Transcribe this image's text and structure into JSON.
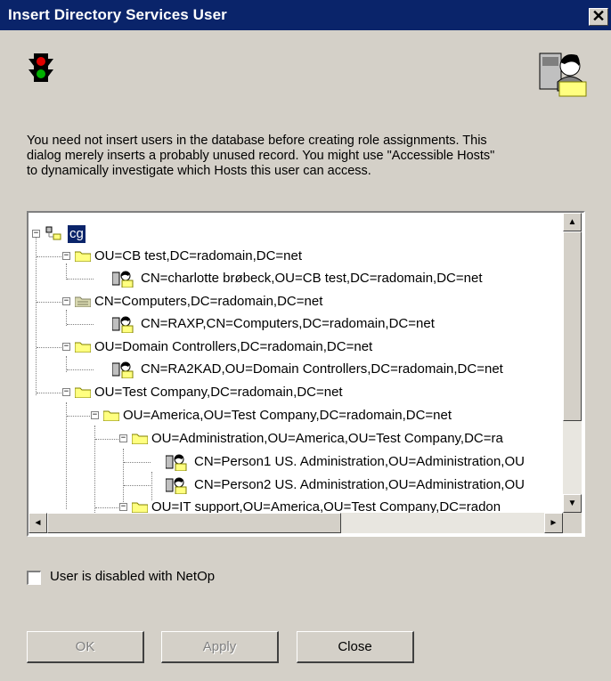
{
  "window": {
    "title": "Insert Directory Services User",
    "close_glyph": "✕"
  },
  "icons": {
    "left": "traffic-light-icon",
    "right": "user-with-folder-icon"
  },
  "description": "You need not insert users in the database before creating role assignments. This\ndialog merely inserts a probably unused record. You might use \"Accessible Hosts\"\nto dynamically investigate which Hosts this user can access.",
  "tree": {
    "items": [
      {
        "label": "cg",
        "selected": true,
        "icon": "network-root-icon",
        "expanded": true
      },
      {
        "label": "OU=CB test,DC=radomain,DC=net",
        "icon": "folder-icon",
        "expanded": true
      },
      {
        "label": "CN=charlotte brøbeck,OU=CB test,DC=radomain,DC=net",
        "icon": "user-icon"
      },
      {
        "label": "CN=Computers,DC=radomain,DC=net",
        "icon": "folder-icon",
        "expanded": true
      },
      {
        "label": "CN=RAXP,CN=Computers,DC=radomain,DC=net",
        "icon": "user-icon"
      },
      {
        "label": "OU=Domain Controllers,DC=radomain,DC=net",
        "icon": "folder-icon",
        "expanded": true
      },
      {
        "label": "CN=RA2KAD,OU=Domain Controllers,DC=radomain,DC=net",
        "icon": "user-icon"
      },
      {
        "label": "OU=Test Company,DC=radomain,DC=net",
        "icon": "folder-icon",
        "expanded": true
      },
      {
        "label": "OU=America,OU=Test Company,DC=radomain,DC=net",
        "icon": "folder-icon",
        "expanded": true
      },
      {
        "label": "OU=Administration,OU=America,OU=Test Company,DC=ra",
        "icon": "folder-icon",
        "expanded": true
      },
      {
        "label": "CN=Person1 US. Administration,OU=Administration,OU",
        "icon": "user-icon"
      },
      {
        "label": "CN=Person2 US. Administration,OU=Administration,OU",
        "icon": "user-icon"
      },
      {
        "label": "OU=IT support,OU=America,OU=Test Company,DC=radon",
        "icon": "folder-icon",
        "expanded": true
      }
    ]
  },
  "scrollbars": {
    "up": "▲",
    "down": "▼",
    "left": "◄",
    "right": "►"
  },
  "checkbox": {
    "label": "User is disabled with NetOp",
    "checked": false
  },
  "buttons": {
    "ok": "OK",
    "apply": "Apply",
    "close": "Close"
  }
}
